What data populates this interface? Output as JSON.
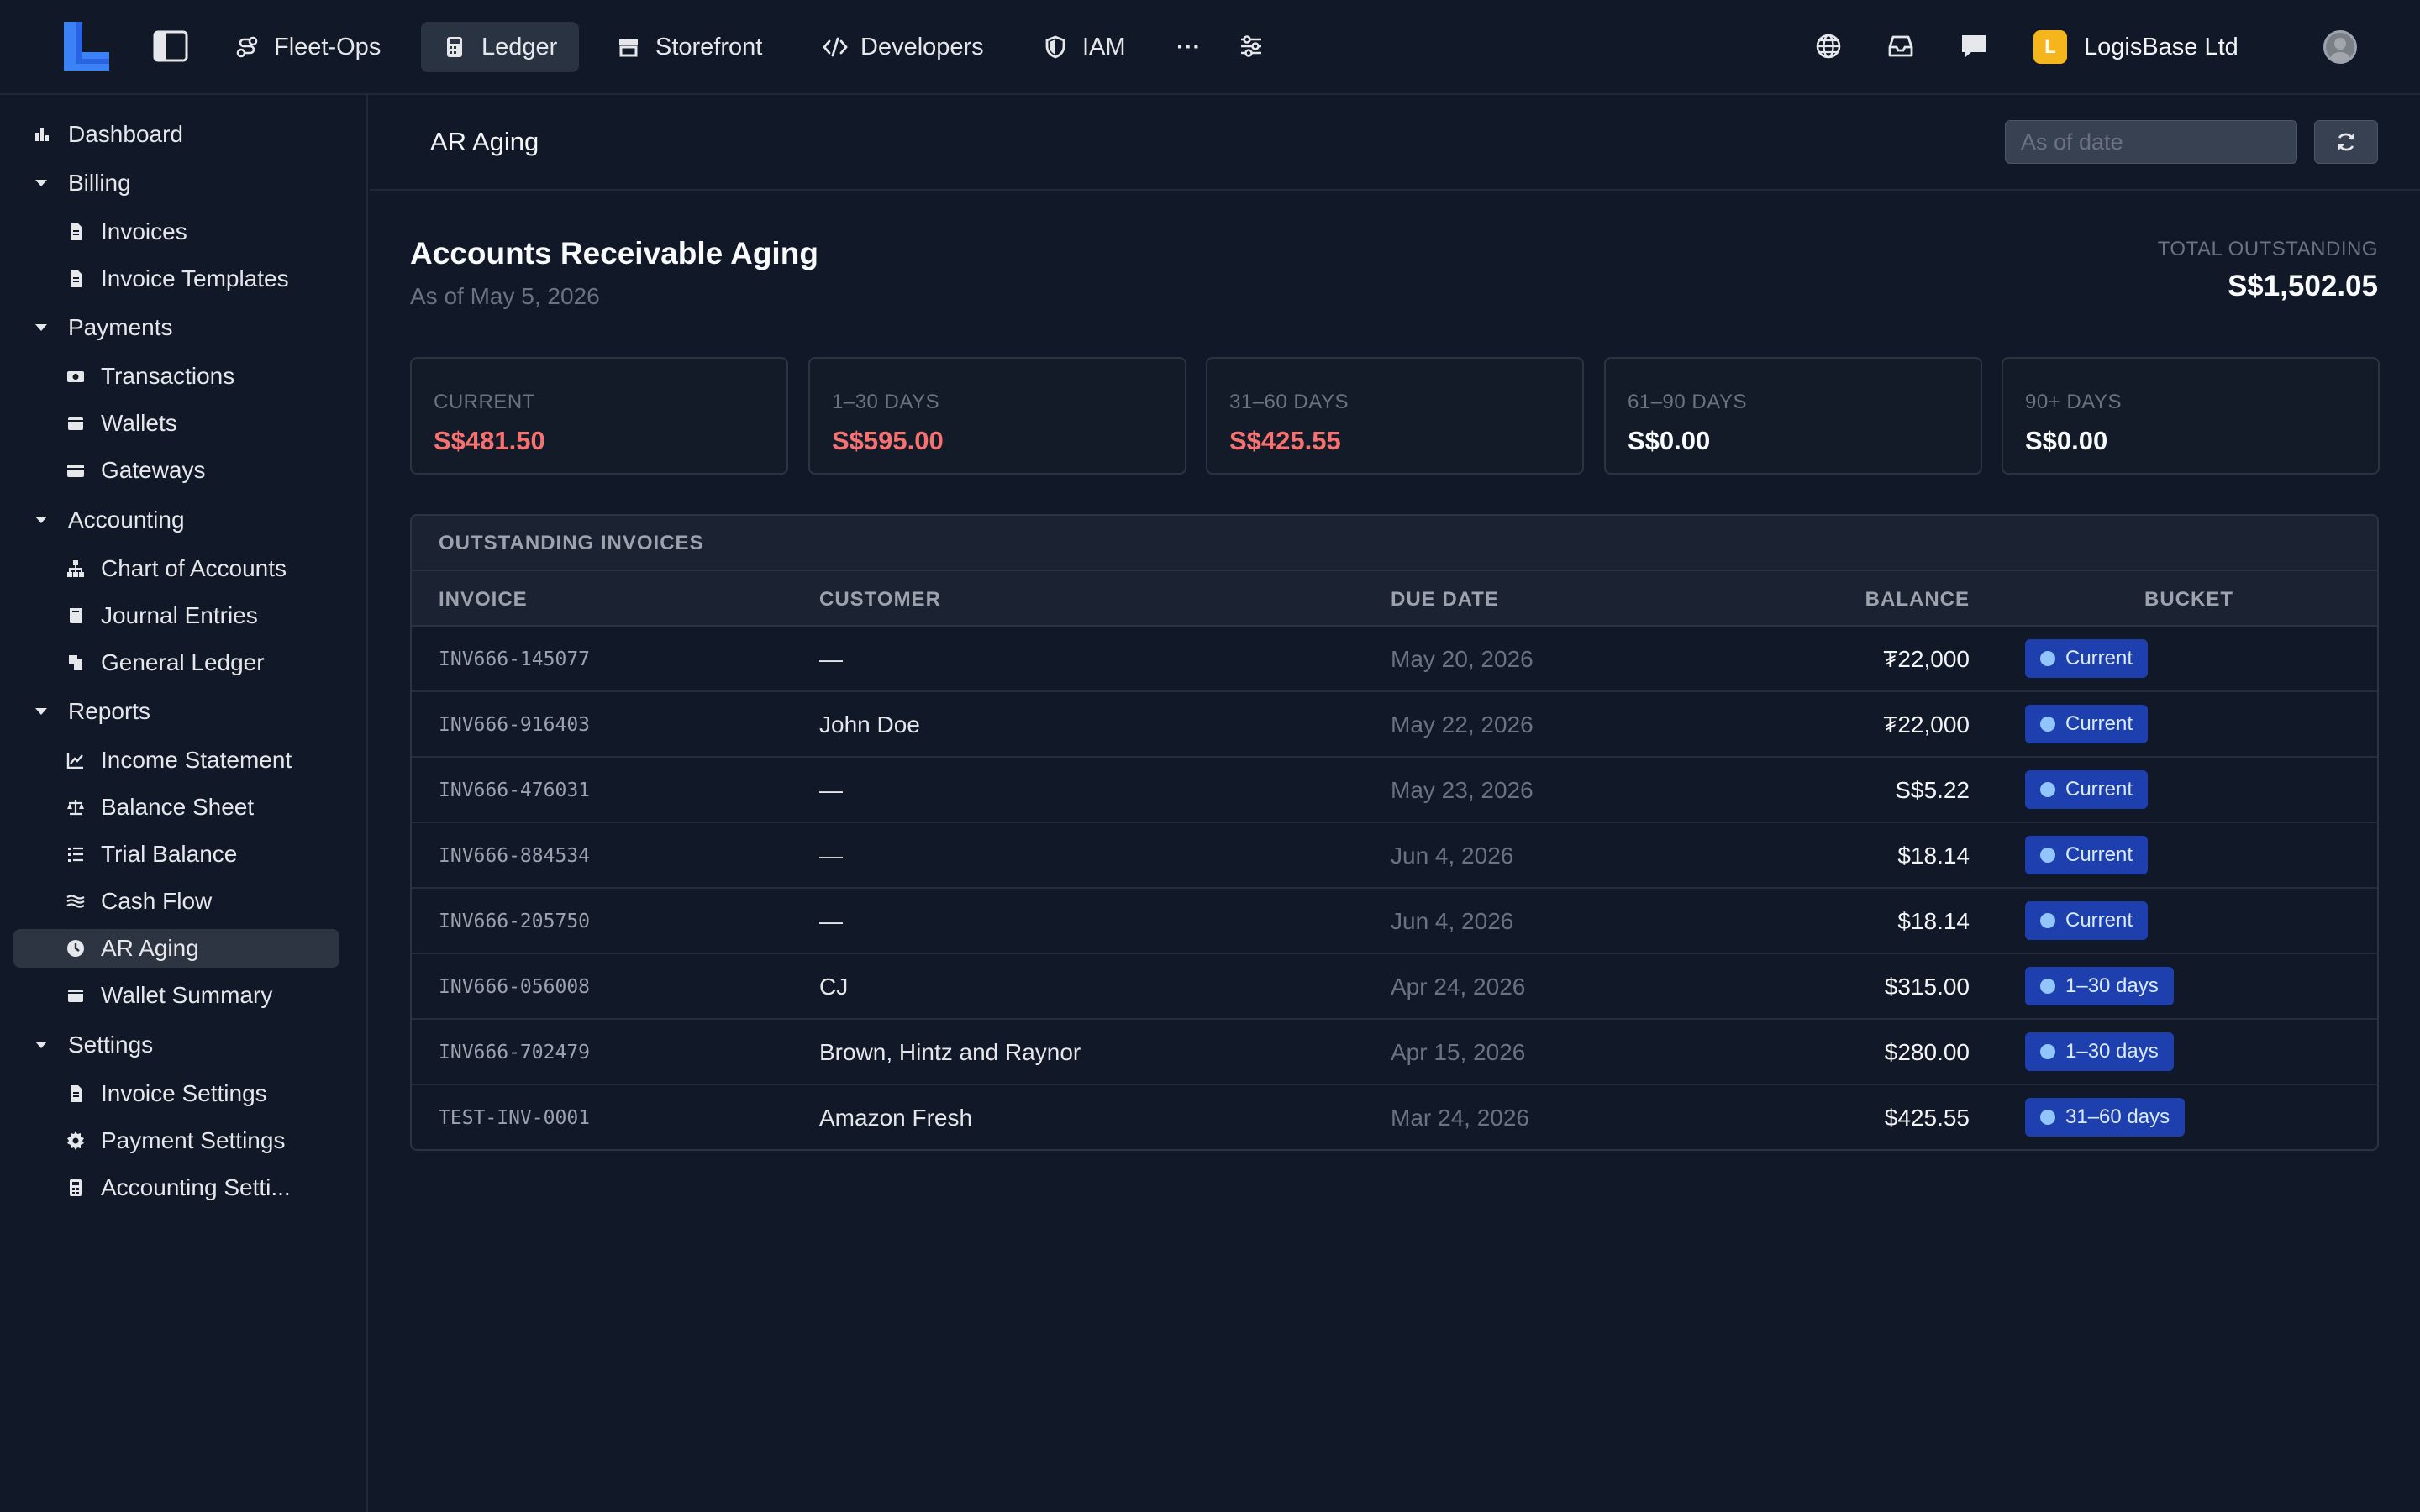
{
  "topbar": {
    "tabs": [
      {
        "label": "Fleet-Ops",
        "icon": "route-icon"
      },
      {
        "label": "Ledger",
        "icon": "calculator-icon",
        "active": true
      },
      {
        "label": "Storefront",
        "icon": "store-icon"
      },
      {
        "label": "Developers",
        "icon": "code-icon"
      },
      {
        "label": "IAM",
        "icon": "shield-icon"
      }
    ],
    "more_label": "···",
    "org": {
      "badge": "L",
      "name": "LogisBase Ltd"
    }
  },
  "sidebar": {
    "dashboard": "Dashboard",
    "billing": {
      "label": "Billing",
      "items": [
        "Invoices",
        "Invoice Templates"
      ]
    },
    "payments": {
      "label": "Payments",
      "items": [
        "Transactions",
        "Wallets",
        "Gateways"
      ]
    },
    "accounting": {
      "label": "Accounting",
      "items": [
        "Chart of Accounts",
        "Journal Entries",
        "General Ledger"
      ]
    },
    "reports": {
      "label": "Reports",
      "items": [
        "Income Statement",
        "Balance Sheet",
        "Trial Balance",
        "Cash Flow",
        "AR Aging",
        "Wallet Summary"
      ]
    },
    "settings": {
      "label": "Settings",
      "items": [
        "Invoice Settings",
        "Payment Settings",
        "Accounting Setti..."
      ]
    },
    "active_item": "AR Aging"
  },
  "header": {
    "breadcrumb": "AR Aging",
    "date_placeholder": "As of date"
  },
  "report": {
    "title": "Accounts Receivable Aging",
    "subtitle": "As of May 5, 2026",
    "total_label": "TOTAL OUTSTANDING",
    "total_value": "S$1,502.05"
  },
  "buckets": [
    {
      "label": "CURRENT",
      "value": "S$481.50",
      "color": "#f87171"
    },
    {
      "label": "1–30 DAYS",
      "value": "S$595.00",
      "color": "#f87171"
    },
    {
      "label": "31–60 DAYS",
      "value": "S$425.55",
      "color": "#f87171"
    },
    {
      "label": "61–90 DAYS",
      "value": "S$0.00",
      "color": "#f9fafb"
    },
    {
      "label": "90+ DAYS",
      "value": "S$0.00",
      "color": "#f9fafb"
    }
  ],
  "table": {
    "caption": "OUTSTANDING INVOICES",
    "columns": [
      "INVOICE",
      "CUSTOMER",
      "DUE DATE",
      "BALANCE",
      "BUCKET"
    ],
    "rows": [
      {
        "invoice": "INV666-145077",
        "customer": "—",
        "due": "May 20, 2026",
        "balance": "₮22,000",
        "bucket": "Current"
      },
      {
        "invoice": "INV666-916403",
        "customer": "John Doe",
        "due": "May 22, 2026",
        "balance": "₮22,000",
        "bucket": "Current"
      },
      {
        "invoice": "INV666-476031",
        "customer": "—",
        "due": "May 23, 2026",
        "balance": "S$5.22",
        "bucket": "Current"
      },
      {
        "invoice": "INV666-884534",
        "customer": "—",
        "due": "Jun 4, 2026",
        "balance": "$18.14",
        "bucket": "Current"
      },
      {
        "invoice": "INV666-205750",
        "customer": "—",
        "due": "Jun 4, 2026",
        "balance": "$18.14",
        "bucket": "Current"
      },
      {
        "invoice": "INV666-056008",
        "customer": "CJ",
        "due": "Apr 24, 2026",
        "balance": "$315.00",
        "bucket": "1–30 days"
      },
      {
        "invoice": "INV666-702479",
        "customer": "Brown, Hintz and Raynor",
        "due": "Apr 15, 2026",
        "balance": "$280.00",
        "bucket": "1–30 days"
      },
      {
        "invoice": "TEST-INV-0001",
        "customer": "Amazon Fresh",
        "due": "Mar 24, 2026",
        "balance": "$425.55",
        "bucket": "31–60 days"
      }
    ]
  },
  "colors": {
    "accent": "#3b82f6",
    "badge_bg": "#1e40af",
    "overdue": "#f87171",
    "org_badge": "#f5b51c"
  }
}
